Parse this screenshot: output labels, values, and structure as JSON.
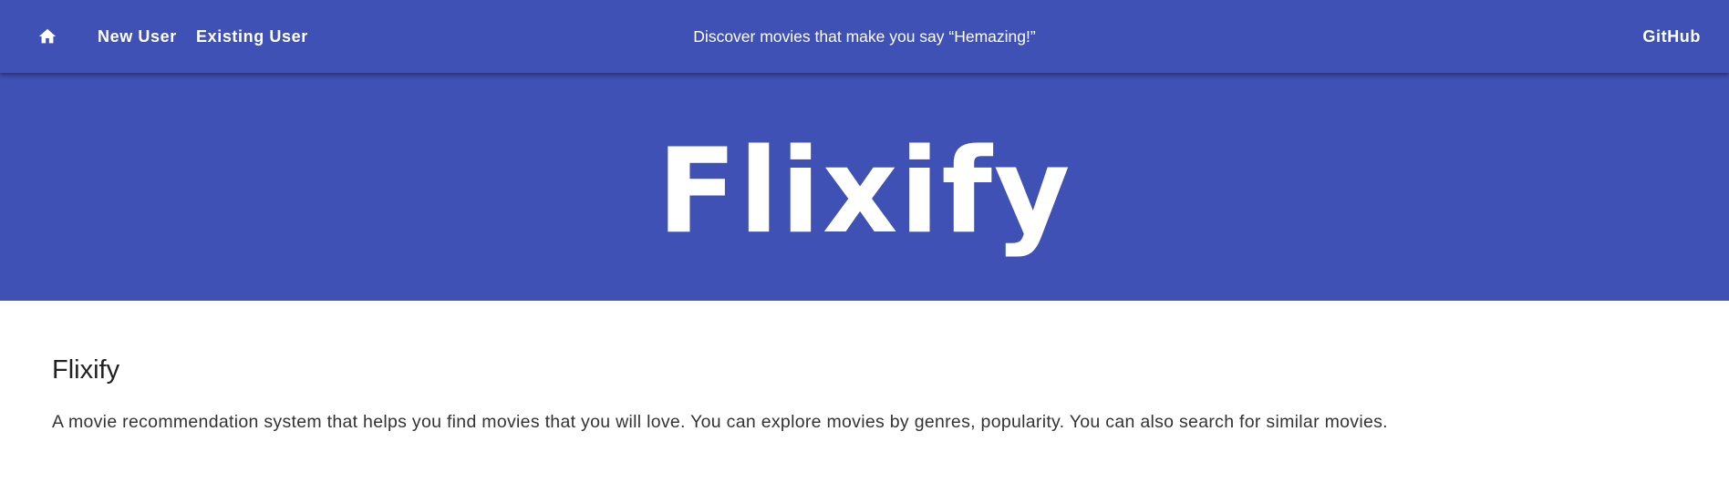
{
  "header": {
    "home_icon": "home-icon",
    "nav": {
      "new_user": "New User",
      "existing_user": "Existing User",
      "github": "GitHub"
    },
    "tagline": "Discover movies that make you say “Hemazing!”"
  },
  "hero": {
    "logo_text": "Flixify"
  },
  "main": {
    "title": "Flixify",
    "description": "A movie recommendation system that helps you find movies that you will love. You can explore movies by genres, popularity. You can also search for similar movies."
  },
  "colors": {
    "primary": "#3f51b5",
    "on_primary": "#ffffff",
    "text": "#222222"
  }
}
